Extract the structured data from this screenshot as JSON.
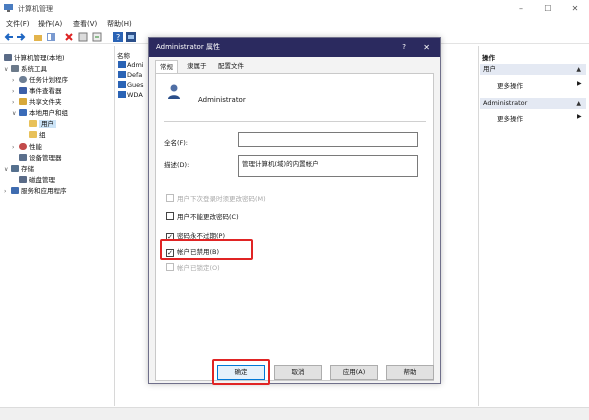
{
  "window": {
    "title": "计算机管理",
    "minimize": "–",
    "maximize": "☐",
    "close": "✕"
  },
  "menu": [
    "文件(F)",
    "操作(A)",
    "查看(V)",
    "帮助(H)"
  ],
  "tree": [
    {
      "label": "计算机管理(本地)",
      "arrow": "",
      "color": "#5a6b87"
    },
    {
      "label": "系统工具",
      "arrow": "∨",
      "color": "#6c7a8a"
    },
    {
      "label": "任务计划程序",
      "arrow": "›",
      "color": "#6e7f95"
    },
    {
      "label": "事件查看器",
      "arrow": "›",
      "color": "#3c5fa8"
    },
    {
      "label": "共享文件夹",
      "arrow": "›",
      "color": "#d7a83a"
    },
    {
      "label": "本地用户和组",
      "arrow": "∨",
      "color": "#3a6bb8"
    },
    {
      "label": "用户",
      "arrow": "",
      "color": "#e8c15a"
    },
    {
      "label": "组",
      "arrow": "",
      "color": "#e8c15a"
    },
    {
      "label": "性能",
      "arrow": "›",
      "color": "#c24a4a"
    },
    {
      "label": "设备管理器",
      "arrow": "",
      "color": "#5b6f8c"
    },
    {
      "label": "存储",
      "arrow": "∨",
      "color": "#55708e"
    },
    {
      "label": "磁盘管理",
      "arrow": "",
      "color": "#5a6b87"
    },
    {
      "label": "服务和应用程序",
      "arrow": "›",
      "color": "#3f6cb0"
    }
  ],
  "list": {
    "header": "名称",
    "items": [
      "Admi",
      "Defa",
      "Gues",
      "WDA"
    ]
  },
  "actions": {
    "title": "操作",
    "groups": [
      {
        "head": "用户",
        "item": "更多操作"
      },
      {
        "head": "Administrator",
        "item": "更多操作"
      }
    ],
    "caret": "▲",
    "more_arrow": "▶"
  },
  "dialog": {
    "title": "Administrator 属性",
    "help": "?",
    "close": "✕",
    "tabs": [
      "常规",
      "隶属于",
      "配置文件"
    ],
    "username": "Administrator",
    "fullname_label": "全名(F):",
    "fullname_value": "",
    "desc_label": "描述(D):",
    "desc_value": "管理计算机(域)的内置帐户",
    "checkboxes": [
      {
        "label": "用户下次登录时须更改密码(M)",
        "checked": false,
        "disabled": true
      },
      {
        "label": "用户不能更改密码(C)",
        "checked": false,
        "disabled": false
      },
      {
        "label": "密码永不过期(P)",
        "checked": true,
        "disabled": false
      },
      {
        "label": "帐户已禁用(B)",
        "checked": true,
        "disabled": false
      },
      {
        "label": "帐户已锁定(O)",
        "checked": false,
        "disabled": true
      }
    ],
    "check_mark": "✓",
    "buttons": [
      "确定",
      "取消",
      "应用(A)",
      "帮助"
    ],
    "highlight_color": "#e02424"
  }
}
